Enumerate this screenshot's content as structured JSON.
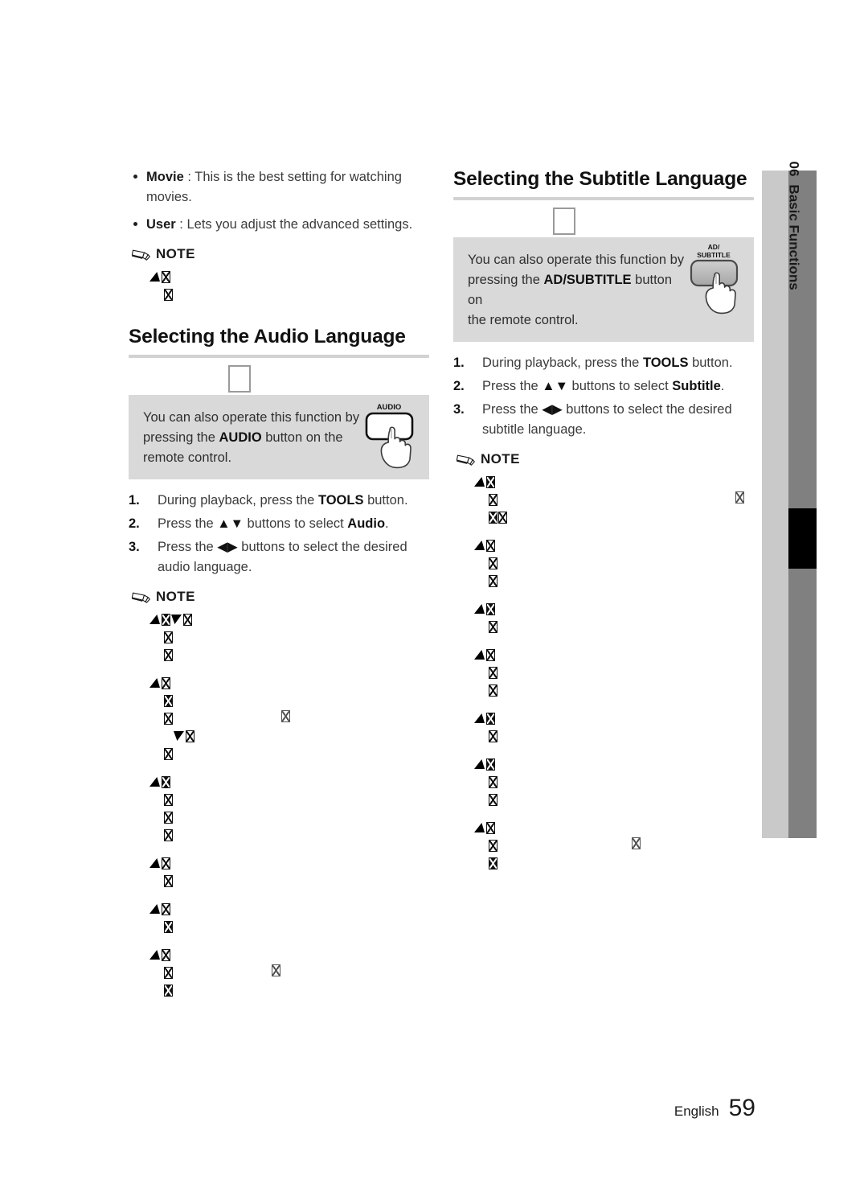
{
  "page": {
    "footer_language": "English",
    "footer_page_number": "59"
  },
  "side_tab": {
    "chapter_number": "06",
    "chapter_title": "Basic Functions",
    "light_band_color": "#c9c9c9",
    "dark_band_color": "#808080",
    "marker_color": "#000000"
  },
  "left_column": {
    "bullets": [
      {
        "term": "Movie",
        "separator": " : ",
        "text": "This is the best setting for watching movies."
      },
      {
        "term": "User",
        "separator": " : ",
        "text": "Lets you adjust the advanced settings."
      }
    ],
    "note_label": "NOTE",
    "section": {
      "title": "Selecting the Audio Language",
      "infobox": {
        "line1": "You can also operate this function by",
        "line2_pre": "pressing the ",
        "line2_strong": "AUDIO",
        "line2_post": " button on the",
        "line3": "remote control.",
        "remote_button_label": "AUDIO",
        "remote_button_fill": "#ffffff",
        "background_color": "#d9d9d9"
      },
      "steps": [
        {
          "num": "1.",
          "pre": "During playback, press the ",
          "strong": "TOOLS",
          "post": " button."
        },
        {
          "num": "2.",
          "pre": "Press the ",
          "arrows": "▲▼",
          "mid": " buttons to select ",
          "strong": "Audio",
          "post": "."
        },
        {
          "num": "3.",
          "pre": "Press the ",
          "arrows": "◀▶",
          "mid": " buttons to select the desired",
          "post2": "audio language."
        }
      ],
      "note_label": "NOTE"
    }
  },
  "right_column": {
    "section": {
      "title": "Selecting the Subtitle Language",
      "infobox": {
        "line1": "You can also operate this function by",
        "line2_pre": "pressing the ",
        "line2_strong": "AD/SUBTITLE",
        "line2_post": " button on",
        "line3": "the remote control.",
        "remote_button_label_line1": "AD/",
        "remote_button_label_line2": "SUBTITLE",
        "remote_button_fill": "#b9b9b9",
        "background_color": "#d9d9d9"
      },
      "steps": [
        {
          "num": "1.",
          "pre": "During playback, press the ",
          "strong": "TOOLS",
          "post": " button."
        },
        {
          "num": "2.",
          "pre": "Press the ",
          "arrows": "▲▼",
          "mid": " buttons to select ",
          "strong": "Subtitle",
          "post": "."
        },
        {
          "num": "3.",
          "pre": "Press the ",
          "arrows": "◀▶",
          "mid": " buttons to select the desired",
          "post2": "subtitle language."
        }
      ],
      "note_label": "NOTE"
    }
  }
}
